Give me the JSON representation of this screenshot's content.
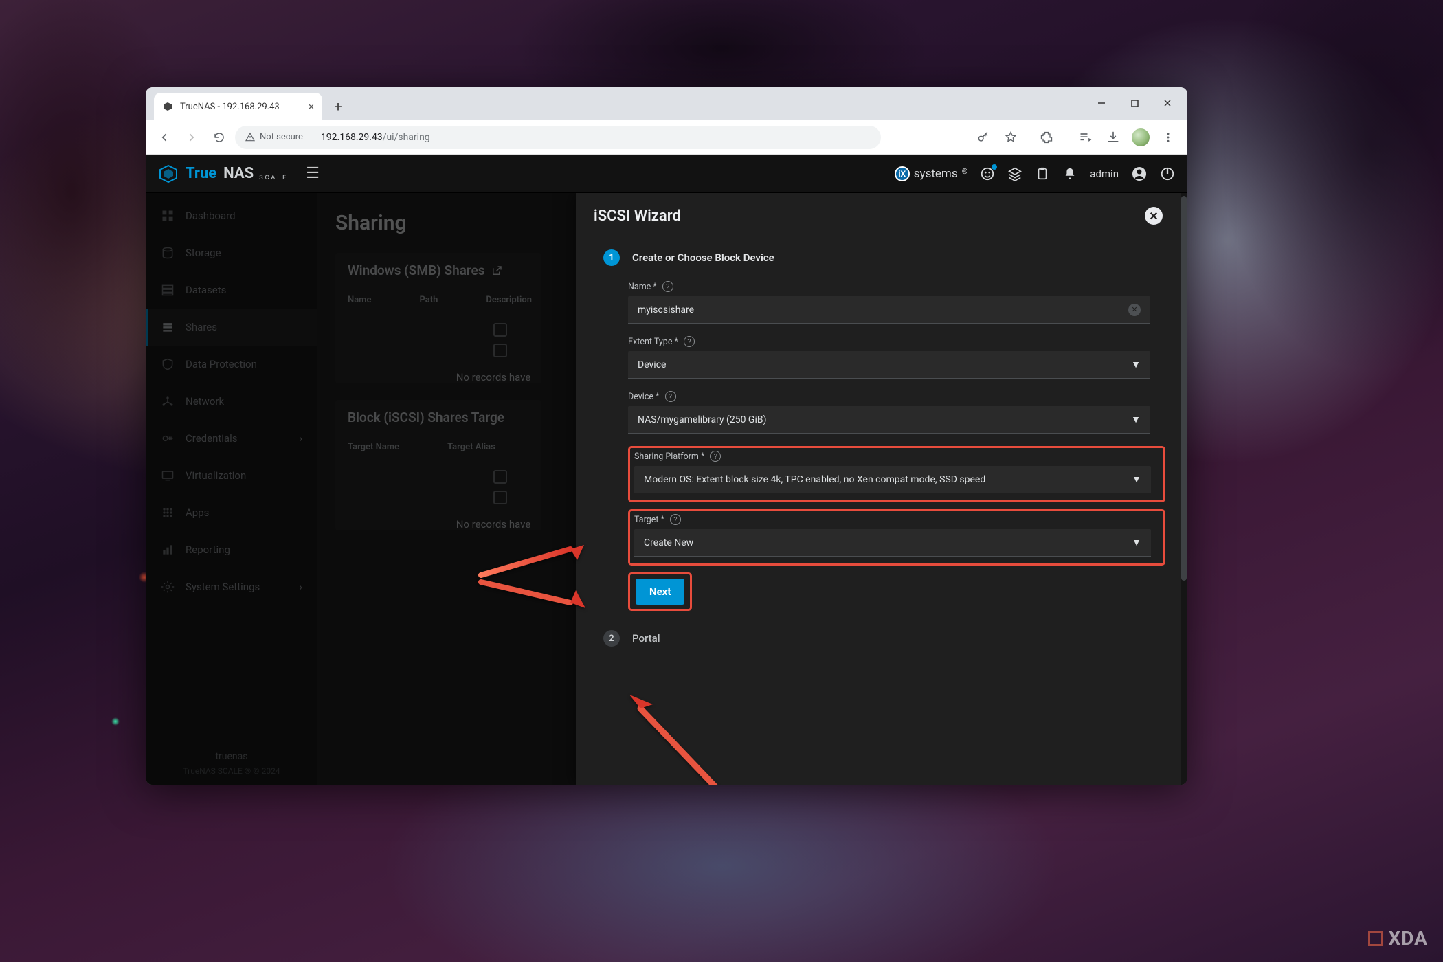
{
  "browser": {
    "tab_title": "TrueNAS - 192.168.29.43",
    "url_host": "192.168.29.43",
    "url_path": "/ui/sharing",
    "not_secure": "Not secure"
  },
  "header": {
    "brand1": "True",
    "brand2": "NAS",
    "scale": "SCALE",
    "ix": "systems",
    "user": "admin"
  },
  "sidebar": {
    "items": [
      {
        "label": "Dashboard"
      },
      {
        "label": "Storage"
      },
      {
        "label": "Datasets"
      },
      {
        "label": "Shares"
      },
      {
        "label": "Data Protection"
      },
      {
        "label": "Network"
      },
      {
        "label": "Credentials"
      },
      {
        "label": "Virtualization"
      },
      {
        "label": "Apps"
      },
      {
        "label": "Reporting"
      },
      {
        "label": "System Settings"
      }
    ],
    "footer_host": "truenas",
    "footer_ver": "TrueNAS SCALE ® © 2024"
  },
  "content": {
    "page_title": "Sharing",
    "smb_title": "Windows (SMB) Shares",
    "smb_cols": {
      "c1": "Name",
      "c2": "Path",
      "c3": "Description"
    },
    "no_records": "No records have",
    "iscsi_title": "Block (iSCSI) Shares Targe",
    "iscsi_cols": {
      "c1": "Target Name",
      "c2": "Target Alias"
    }
  },
  "panel": {
    "title": "iSCSI Wizard",
    "step1_label": "Create or Choose Block Device",
    "step2_label": "Portal",
    "fields": {
      "name_label": "Name *",
      "name_value": "myiscsishare",
      "extent_label": "Extent Type *",
      "extent_value": "Device",
      "device_label": "Device *",
      "device_value": "NAS/mygamelibrary (250 GiB)",
      "platform_label": "Sharing Platform *",
      "platform_value": "Modern OS: Extent block size 4k, TPC enabled, no Xen compat mode, SSD speed",
      "target_label": "Target *",
      "target_value": "Create New",
      "next": "Next"
    }
  },
  "watermark": "XDA"
}
